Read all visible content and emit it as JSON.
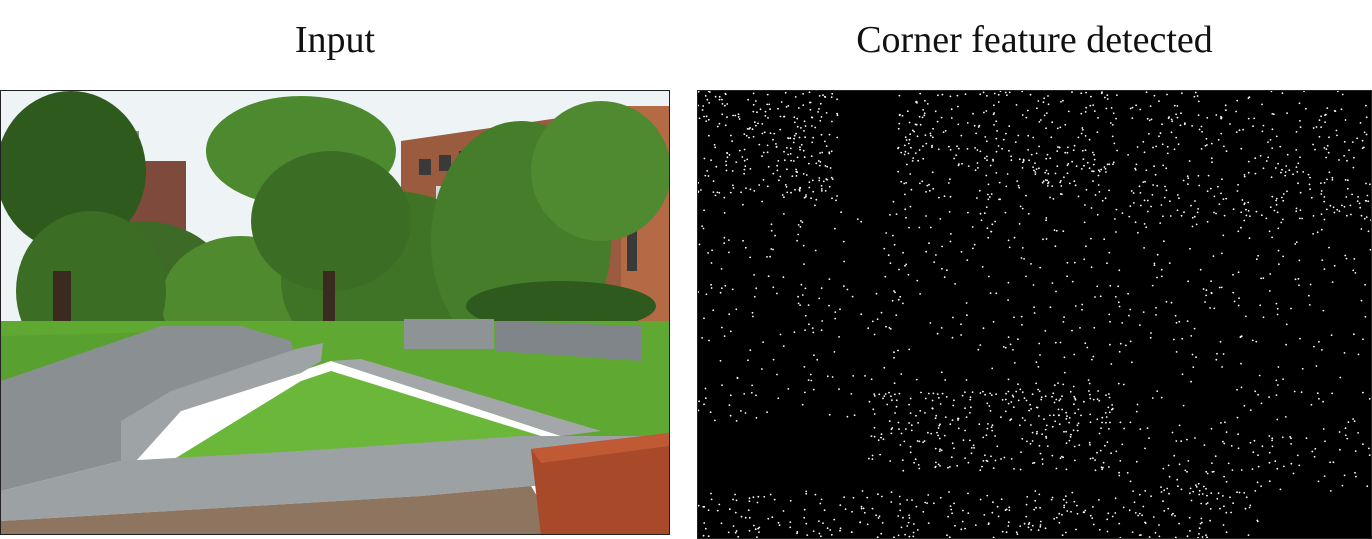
{
  "panels": {
    "left": {
      "caption": "Input"
    },
    "right": {
      "caption": "Corner feature detected"
    }
  },
  "colors": {
    "sky": "#eef3f6",
    "grass": "#5fa832",
    "foliage_dark": "#2f5a1e",
    "foliage_light": "#5d9a36",
    "brick": "#9a5b3e",
    "path": "#8a8f92",
    "bench": "#a8492a",
    "corner_dot": "#ffffff"
  }
}
